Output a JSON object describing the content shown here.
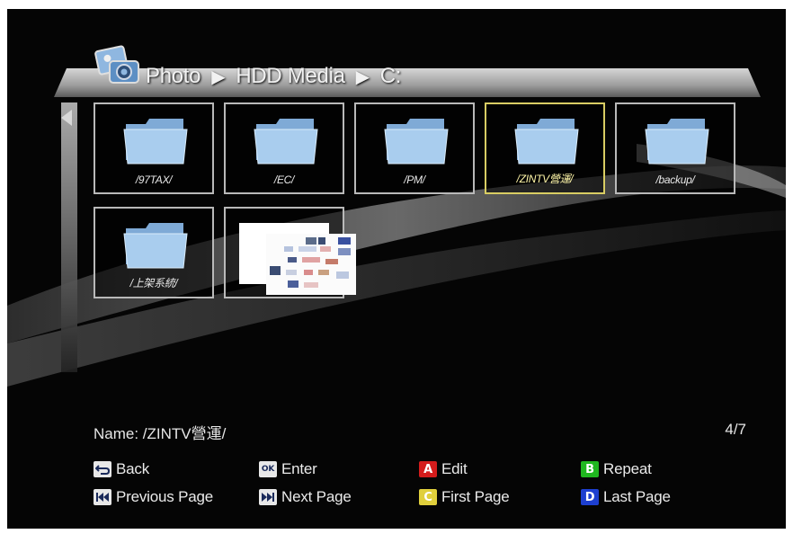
{
  "header": {
    "breadcrumb": [
      "Photo",
      "HDD Media",
      "C:"
    ],
    "separator": "▶",
    "icon": "photo-app-icon"
  },
  "grid": {
    "items": [
      {
        "label": "/97TAX/",
        "type": "folder",
        "selected": false
      },
      {
        "label": "/EC/",
        "type": "folder",
        "selected": false
      },
      {
        "label": "/PM/",
        "type": "folder",
        "selected": false
      },
      {
        "label": "/ZINTV營運/",
        "type": "folder",
        "selected": true
      },
      {
        "label": "/backup/",
        "type": "folder",
        "selected": false
      },
      {
        "label": "/上架系統/",
        "type": "folder",
        "selected": false
      },
      {
        "label": "",
        "type": "image",
        "selected": false
      }
    ]
  },
  "status": {
    "name_prefix": "Name: ",
    "name_value": "/ZINTV營運/",
    "page": "4/7"
  },
  "legend": {
    "back": {
      "key": "back-key-icon",
      "label": "Back"
    },
    "enter": {
      "key": "OK",
      "label": "Enter"
    },
    "edit": {
      "key": "A",
      "label": "Edit",
      "color": "#d41c1c"
    },
    "repeat": {
      "key": "B",
      "label": "Repeat",
      "color": "#1fb81f"
    },
    "prev": {
      "key": "prev-page-icon",
      "label": "Previous Page"
    },
    "next": {
      "key": "next-page-icon",
      "label": "Next Page"
    },
    "first": {
      "key": "C",
      "label": "First Page",
      "color": "#e0cf3c"
    },
    "last": {
      "key": "D",
      "label": "Last Page",
      "color": "#1d3fd0"
    }
  },
  "colors": {
    "background": "#050505",
    "selection": "#d9cd63",
    "tile_border": "#b9b9b9",
    "folder": "#9fc7ea"
  }
}
